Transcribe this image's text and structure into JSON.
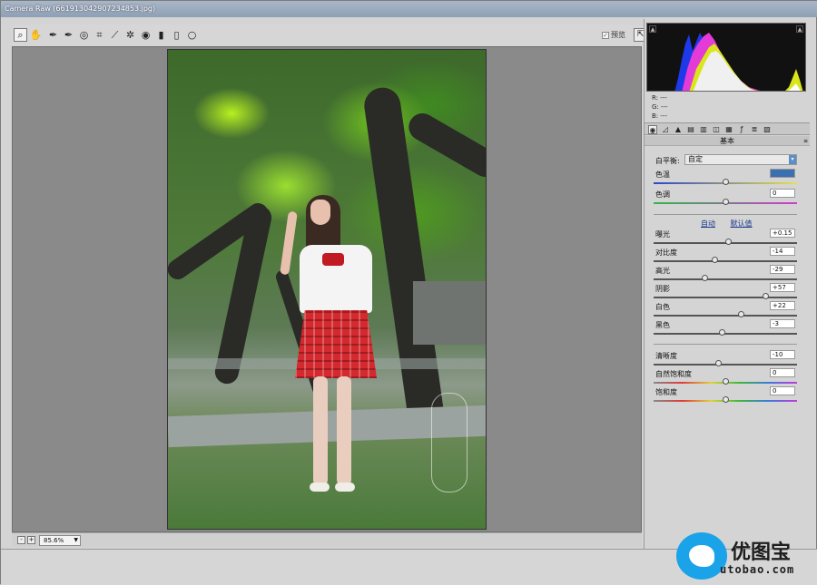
{
  "window": {
    "title": "Camera Raw (661913042907234853.jpg)"
  },
  "toolbar": {
    "tools": [
      "zoom-icon",
      "hand-icon",
      "white-balance-icon",
      "color-sampler-icon",
      "targeted-adjust-icon",
      "crop-icon",
      "straighten-icon",
      "spot-removal-icon",
      "red-eye-icon",
      "adjustment-brush-icon",
      "graduated-filter-icon",
      "radial-filter-icon"
    ],
    "preview_label": "预览"
  },
  "status": {
    "zoom": "85.6%"
  },
  "histogram": {
    "r": "R:  ---",
    "g": "G:  ---",
    "b": "B:  ---"
  },
  "panel": {
    "title": "基本",
    "white_balance": {
      "label": "白平衡:",
      "value": "自定"
    },
    "auto_label": "自动",
    "default_label": "默认值",
    "sliders": [
      {
        "key": "temp",
        "label": "色温",
        "value": "",
        "pos": 0.5,
        "highlight": true
      },
      {
        "key": "tint",
        "label": "色调",
        "value": "0",
        "pos": 0.5
      },
      {
        "key": "exposure",
        "label": "曝光",
        "value": "+0.15",
        "pos": 0.52
      },
      {
        "key": "contrast",
        "label": "对比度",
        "value": "-14",
        "pos": 0.43
      },
      {
        "key": "highlights",
        "label": "高光",
        "value": "-29",
        "pos": 0.36
      },
      {
        "key": "shadows",
        "label": "阴影",
        "value": "+57",
        "pos": 0.78
      },
      {
        "key": "whites",
        "label": "白色",
        "value": "+22",
        "pos": 0.61
      },
      {
        "key": "blacks",
        "label": "黑色",
        "value": "-3",
        "pos": 0.48
      },
      {
        "key": "clarity",
        "label": "清晰度",
        "value": "-10",
        "pos": 0.45
      },
      {
        "key": "vibrance",
        "label": "自然饱和度",
        "value": "0",
        "pos": 0.5
      },
      {
        "key": "saturation",
        "label": "饱和度",
        "value": "0",
        "pos": 0.5
      }
    ]
  },
  "logo": {
    "name": "优图宝",
    "url": "utobao.com"
  },
  "colors": {
    "accent": "#3a6fb0",
    "canvas": "#8a8a8a",
    "logo_blue": "#1aa3e8"
  }
}
